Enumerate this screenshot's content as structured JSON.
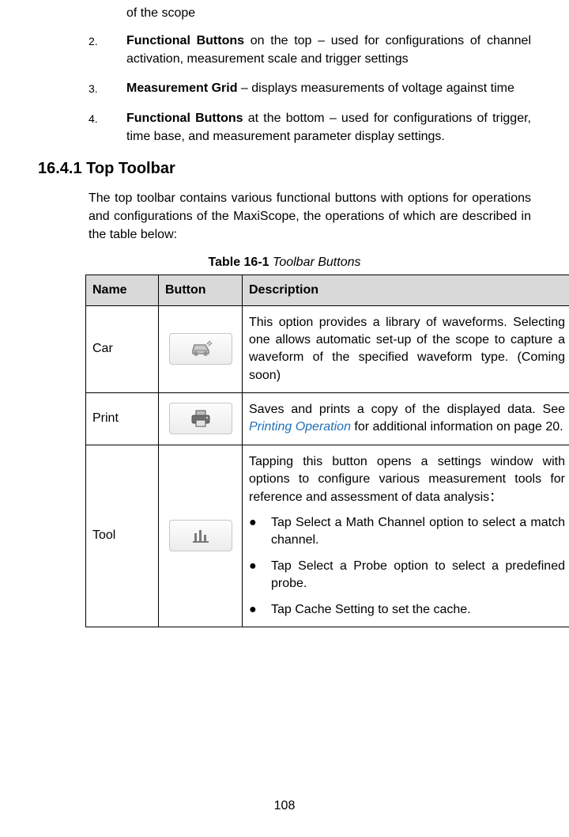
{
  "list": {
    "pretext": "of the scope",
    "items": [
      {
        "num": "2.",
        "bold": "Functional Buttons",
        "rest": " on the top – used for configurations of channel activation, measurement scale and trigger settings"
      },
      {
        "num": "3.",
        "bold": "Measurement Grid",
        "rest": " – displays measurements of voltage against time"
      },
      {
        "num": "4.",
        "bold": "Functional Buttons",
        "rest": " at the bottom – used for configurations of trigger, time base, and measurement parameter display settings."
      }
    ]
  },
  "heading": "16.4.1 Top Toolbar",
  "intro": "The top toolbar contains various functional buttons with options for operations and configurations of the MaxiScope, the operations of which are described in the table below:",
  "tableCaption": {
    "bold": "Table 16-1",
    "italic": " Toolbar Buttons"
  },
  "headers": {
    "name": "Name",
    "button": "Button",
    "desc": "Description"
  },
  "rows": [
    {
      "name": "Car",
      "icon": "car-icon",
      "desc": "This option provides a library of waveforms. Selecting one allows automatic set-up of the scope to capture a waveform of the specified waveform type. (Coming soon)"
    },
    {
      "name": "Print",
      "icon": "print-icon",
      "descPre": "Saves and prints a copy of the displayed data. See ",
      "descLink": "Printing Operation",
      "descPost": " for additional information on page 20."
    },
    {
      "name": "Tool",
      "icon": "tool-icon",
      "intro": "Tapping this button opens a settings window with options to configure various measurement tools for reference and assessment of data analysis：",
      "bullets": [
        "Tap Select a Math Channel option to select a match channel.",
        "Tap Select a Probe option to select a predefined probe.",
        "Tap Cache Setting to set the cache."
      ]
    }
  ],
  "pageNumber": "108"
}
